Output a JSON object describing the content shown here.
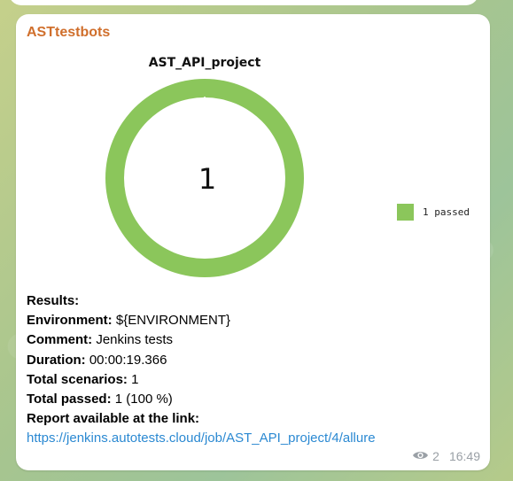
{
  "message": {
    "sender": "ASTtestbots",
    "views": "2",
    "time": "16:49",
    "lines": [
      {
        "label": "Results:",
        "value": ""
      },
      {
        "label": "Environment:",
        "value": "${ENVIRONMENT}"
      },
      {
        "label": "Comment:",
        "value": "Jenkins tests"
      },
      {
        "label": "Duration:",
        "value": "00:00:19.366"
      },
      {
        "label": "Total scenarios:",
        "value": "1"
      },
      {
        "label": "Total passed:",
        "value": "1 (100 %)"
      },
      {
        "label": "Report available at the link:",
        "value": ""
      }
    ],
    "link": "https://jenkins.autotests.cloud/job/AST_API_project/4/allure"
  },
  "chart_data": {
    "type": "pie",
    "title": "AST_API_project",
    "center_label": "1",
    "slices": [
      {
        "name": "1 passed",
        "value": 1,
        "color": "#8bc65b"
      }
    ],
    "legend_position": "right"
  },
  "icons": {
    "views": "eye-icon"
  }
}
